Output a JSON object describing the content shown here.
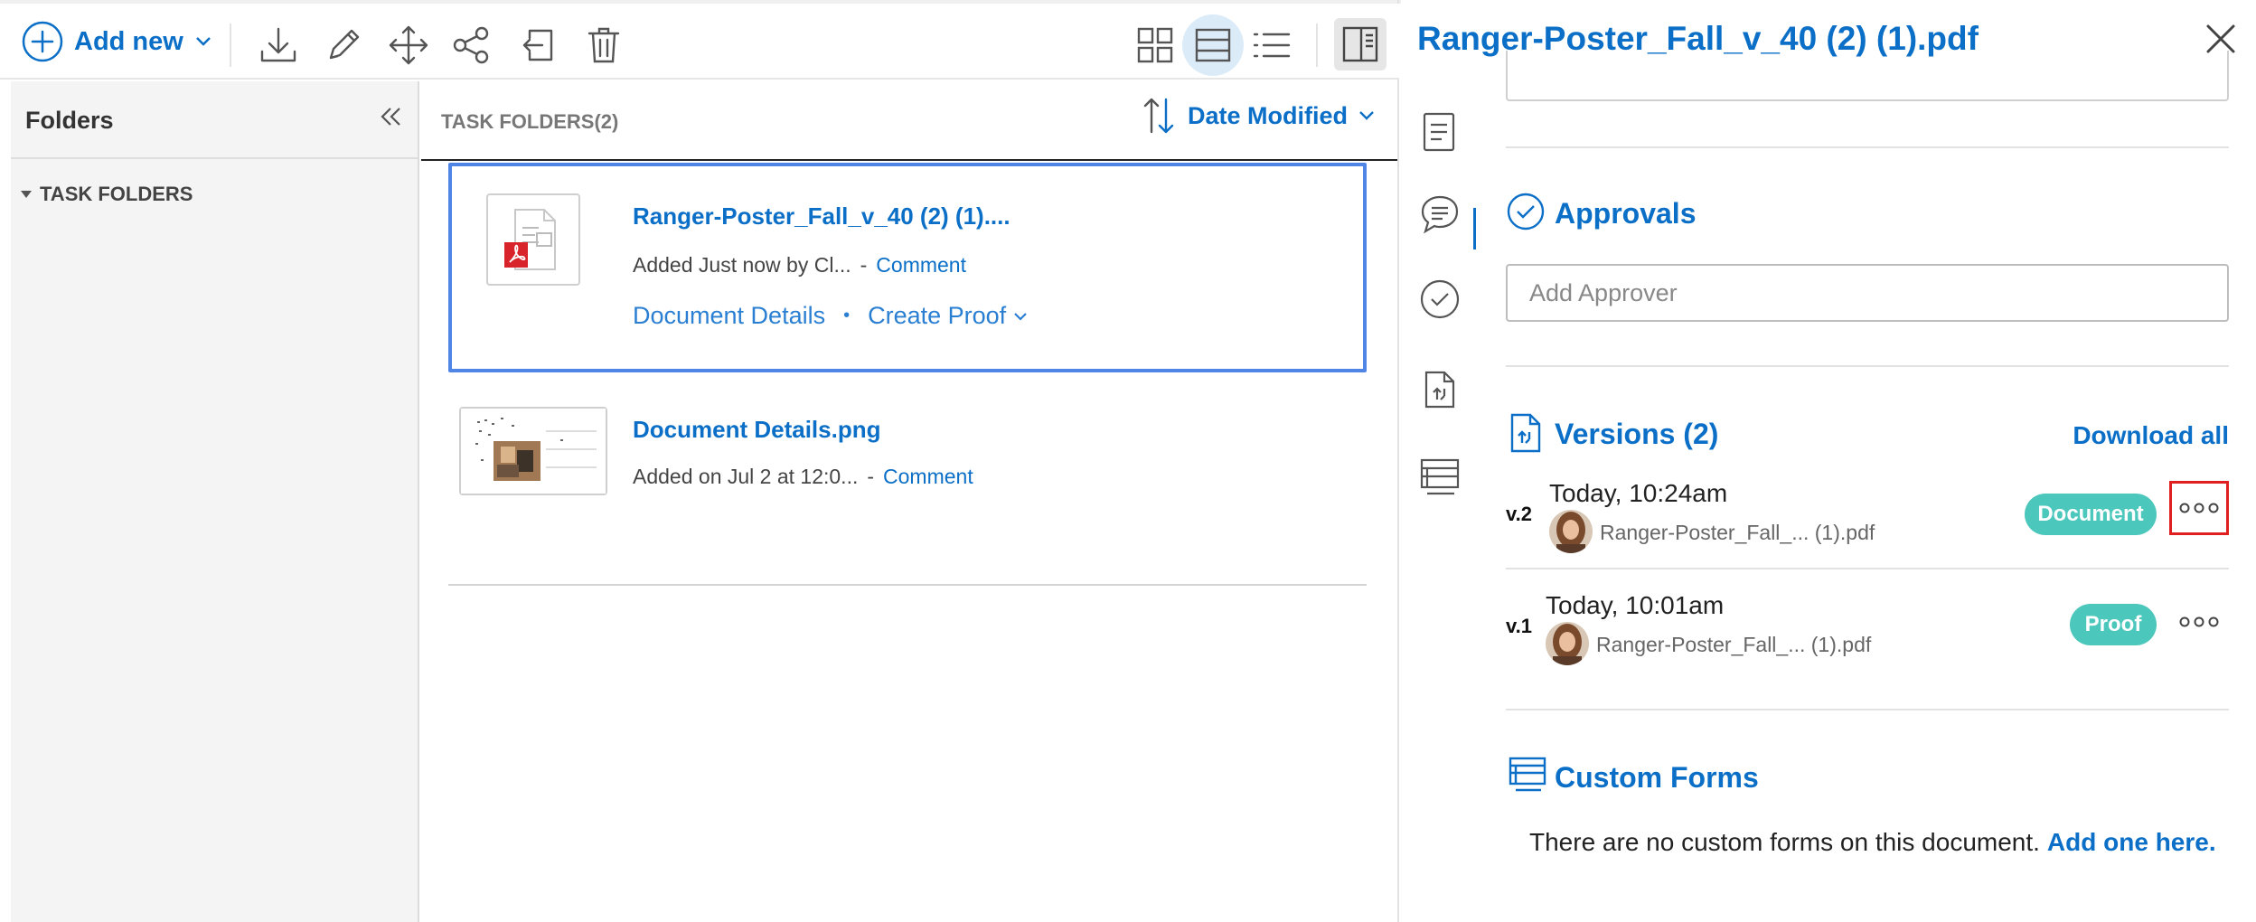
{
  "toolbar": {
    "add_new_label": "Add new",
    "icons": [
      "download-icon",
      "edit-pencil-icon",
      "move-icon",
      "share-icon",
      "exit-icon",
      "trash-icon",
      "grid-view-icon",
      "row-view-icon",
      "list-view-icon",
      "panel-toggle-icon"
    ]
  },
  "sidebar": {
    "title": "Folders",
    "tree": [
      {
        "label": "TASK FOLDERS",
        "expanded": true
      }
    ]
  },
  "list": {
    "header_label": "TASK FOLDERS(2)",
    "sort_label": "Date Modified",
    "items": [
      {
        "name": "Ranger-Poster_Fall_v_40 (2) (1)....",
        "meta": "Added Just now by Cl...",
        "comment_label": "Comment",
        "details_label": "Document Details",
        "proof_label": "Create Proof",
        "selected": true
      },
      {
        "name": "Document Details.png",
        "meta": "Added on Jul 2 at 12:0...",
        "comment_label": "Comment",
        "selected": false
      }
    ]
  },
  "panel": {
    "title": "Ranger-Poster_Fall_v_40 (2) (1).pdf",
    "approvals": {
      "title": "Approvals",
      "placeholder": "Add Approver"
    },
    "versions": {
      "title": "Versions (2)",
      "download_all": "Download all",
      "items": [
        {
          "label": "v.2",
          "time": "Today, 10:24am",
          "file": "Ranger-Poster_Fall_... (1).pdf",
          "badge": "Document"
        },
        {
          "label": "v.1",
          "time": "Today, 10:01am",
          "file": "Ranger-Poster_Fall_... (1).pdf",
          "badge": "Proof"
        }
      ]
    },
    "custom_forms": {
      "title": "Custom Forms",
      "empty_text": "There are no custom forms on this document.",
      "add_link": "Add one here."
    }
  },
  "colors": {
    "accent": "#0b6fc7",
    "badge": "#4cc7bc",
    "selection_border": "#4f86e6",
    "highlight_box": "#e02020"
  }
}
